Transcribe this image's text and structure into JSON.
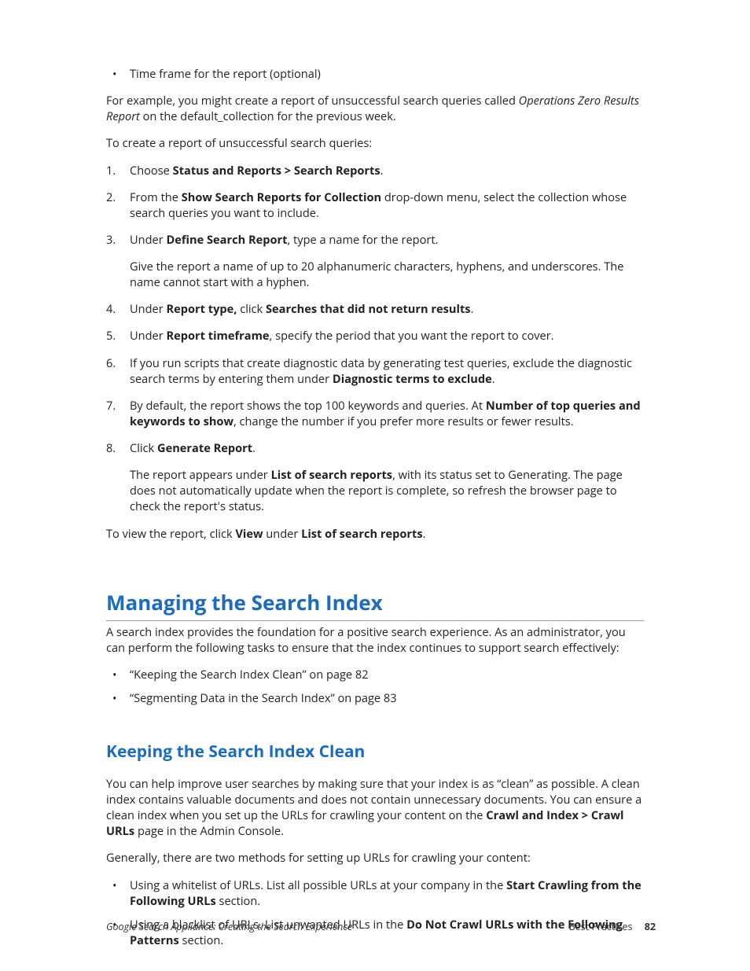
{
  "top_bullets": [
    "Time frame for the report (optional)"
  ],
  "intro_para_pre": "For example, you might create a report of unsuccessful search queries called ",
  "intro_para_italic": "Operations Zero Results Report",
  "intro_para_post": " on the default_collection for the previous week.",
  "lead_in": "To create a report of unsuccessful search queries:",
  "steps": {
    "s1_pre": "Choose ",
    "s1_b": "Status and Reports > Search Reports",
    "s1_post": ".",
    "s2_pre": "From the ",
    "s2_b": "Show Search Reports for Collection",
    "s2_post": " drop-down menu, select the collection whose search queries you want to include.",
    "s3_pre": "Under ",
    "s3_b": "Define Search Report",
    "s3_post": ", type a name for the report.",
    "s3_sub": "Give the report a name of up to 20 alphanumeric characters, hyphens, and underscores. The name cannot start with a hyphen.",
    "s4_pre": "Under ",
    "s4_b1": "Report type,",
    "s4_mid": " click ",
    "s4_b2": "Searches that did not return results",
    "s4_post": ".",
    "s5_pre": "Under ",
    "s5_b": "Report timeframe",
    "s5_post": ", specify the period that you want the report to cover.",
    "s6_pre": "If you run scripts that create diagnostic data by generating test queries, exclude the diagnostic search terms by entering them under ",
    "s6_b": "Diagnostic terms to exclude",
    "s6_post": ".",
    "s7_pre": "By default, the report shows the top 100 keywords and queries. At ",
    "s7_b": "Number of top queries and keywords to show",
    "s7_post": ", change the number if you prefer more results or fewer results.",
    "s8_pre": "Click ",
    "s8_b": "Generate Report",
    "s8_post": ".",
    "s8_sub_pre": "The report appears under ",
    "s8_sub_b": "List of search reports",
    "s8_sub_post": ", with its status set to Generating. The page does not automatically update when the report is complete, so refresh the browser page to check the report's status."
  },
  "closing_pre": "To view the report, click ",
  "closing_b1": "View",
  "closing_mid": " under ",
  "closing_b2": "List of search reports",
  "closing_post": ".",
  "h1": "Managing the Search Index",
  "h1_para": "A search index provides the foundation for a positive search experience. As an administrator, you can perform the following tasks to ensure that the index continues to support search effectively:",
  "h1_bullets": [
    "“Keeping the Search Index Clean” on page 82",
    "“Segmenting Data in the Search Index” on page 83"
  ],
  "h2": "Keeping the Search Index Clean",
  "h2_para_pre": "You can help improve user searches by making sure that your index is as “clean” as possible. A clean index contains valuable documents and does not contain unnecessary documents. You can ensure a clean index when you set up the URLs for crawling your content on the ",
  "h2_para_b": "Crawl and Index > Crawl URLs",
  "h2_para_post": " page in the Admin Console.",
  "h2_para2": "Generally, there are two methods for setting up URLs for crawling your content:",
  "h2_bullets": {
    "b1_pre": "Using a whitelist of URLs. List all possible URLs at your company in the ",
    "b1_b": "Start Crawling from the Following URLs",
    "b1_post": " section.",
    "b2_pre": "Using a blacklist of URLs. List unwanted URLs in the ",
    "b2_b": "Do Not Crawl URLs with the Following Patterns",
    "b2_post": " section."
  },
  "footer": {
    "left": "Google Search Appliance: Creating the Search Experience",
    "right_label": "Best Practices",
    "page_no": "82"
  }
}
